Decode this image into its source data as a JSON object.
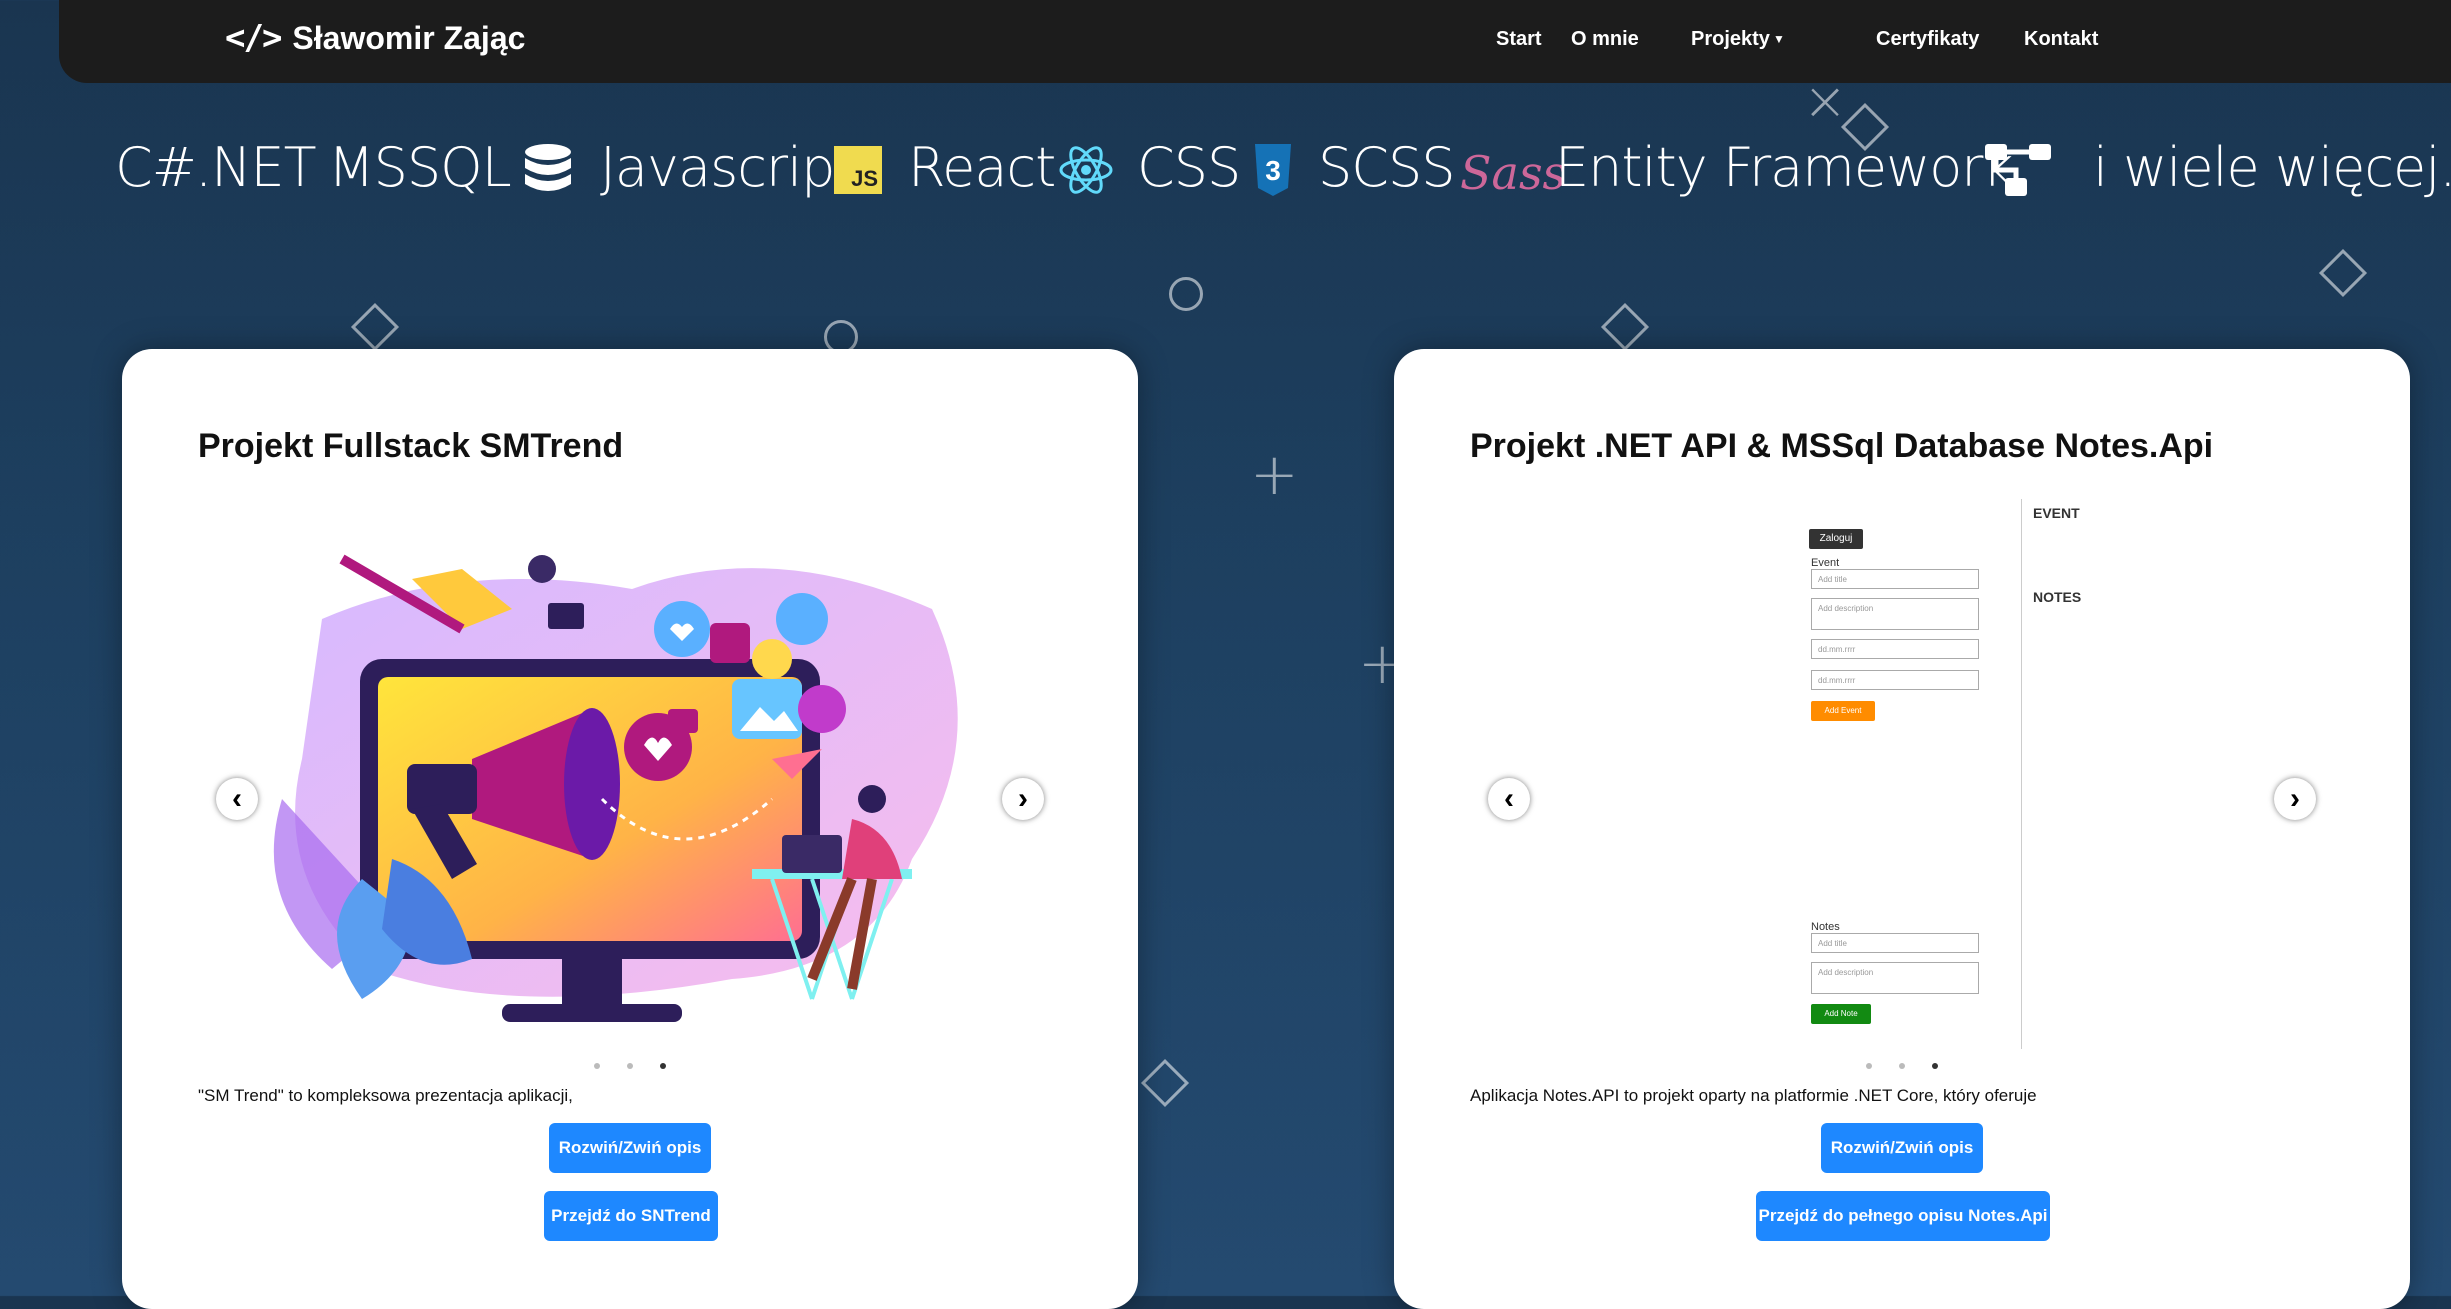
{
  "navbar": {
    "brand": "Sławomir Zając",
    "brand_icon": "code-icon",
    "links": [
      "Start",
      "O mnie",
      "Projekty",
      "Certyfikaty",
      "Kontakt"
    ]
  },
  "tech_stack": {
    "csharp": "C#",
    "dotnet": ".NET",
    "mssql": "MSSQL",
    "javascript": "Javascript",
    "js_badge": "JS",
    "react": "React",
    "css": "CSS",
    "scss": "SCSS",
    "sass_logo": "Sass",
    "ef": "Entity Framework",
    "more": "i wiele więcej..."
  },
  "cards": [
    {
      "title": "Projekt Fullstack SMTrend",
      "description": "\"SM Trend\" to kompleksowa prezentacja aplikacji,",
      "toggle_button": "Rozwiń/Zwiń opis",
      "link_button": "Przejdź do SNTrend",
      "slide_count": 3,
      "active_slide": 3
    },
    {
      "title": "Projekt .NET API & MSSql Database Notes.Api",
      "description": "Aplikacja Notes.API to projekt oparty na platformie .NET Core, który oferuje",
      "toggle_button": "Rozwiń/Zwiń opis",
      "link_button": "Przejdź do pełnego opisu Notes.Api",
      "slide_count": 3,
      "active_slide": 3,
      "screenshot": {
        "login": "Zaloguj",
        "event_label": "Event",
        "add_title": "Add title",
        "add_description": "Add description",
        "date_placeholder": "dd.mm.rrrr",
        "add_event": "Add Event",
        "notes_label": "Notes",
        "add_note": "Add Note",
        "event_heading": "EVENT",
        "notes_heading": "NOTES"
      }
    }
  ],
  "colors": {
    "background": "#1d3f5f",
    "navbar": "#1c1c1c",
    "button": "#1e88ff"
  }
}
